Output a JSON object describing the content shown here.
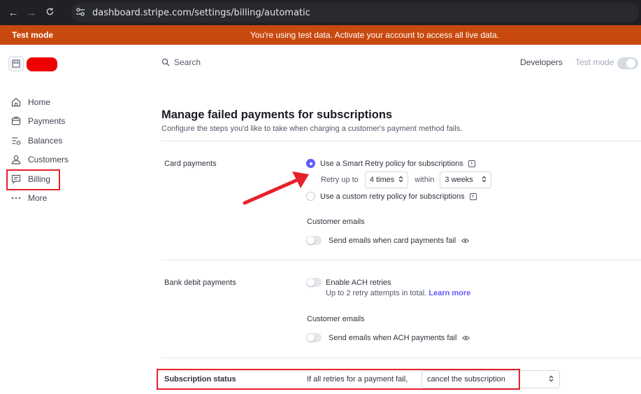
{
  "browser": {
    "url": "dashboard.stripe.com/settings/billing/automatic",
    "back": "←",
    "forward": "→",
    "reload": "C"
  },
  "banner": {
    "label": "Test mode",
    "message": "You're using test data. Activate your account to access all live data."
  },
  "sidebar": {
    "items": [
      {
        "label": "Home"
      },
      {
        "label": "Payments"
      },
      {
        "label": "Balances"
      },
      {
        "label": "Customers"
      },
      {
        "label": "Billing"
      },
      {
        "label": "More"
      }
    ]
  },
  "header": {
    "search_label": "Search",
    "developers": "Developers",
    "test_mode": "Test mode"
  },
  "page": {
    "title": "Manage failed payments for subscriptions",
    "subtitle": "Configure the steps you'd like to take when charging a customer's payment method fails."
  },
  "card": {
    "label": "Card payments",
    "smart_retry": "Use a Smart Retry policy for subscriptions",
    "retry_up_to": "Retry up to",
    "times_value": "4 times",
    "within": "within",
    "weeks_value": "3 weeks",
    "custom_retry": "Use a custom retry policy for subscriptions",
    "customer_emails": "Customer emails",
    "send_emails": "Send emails when card payments fail"
  },
  "bank": {
    "label": "Bank debit payments",
    "enable_ach": "Enable ACH retries",
    "helper": "Up to 2 retry attempts in total.",
    "learn_more": "Learn more",
    "customer_emails": "Customer emails",
    "send_emails": "Send emails when ACH payments fail"
  },
  "status": {
    "label": "Subscription status",
    "text": "If all retries for a payment fail,",
    "select_value": "cancel the subscription"
  },
  "icons": {
    "info": "i",
    "chevron": "⌃⌄"
  },
  "colors": {
    "accent": "#635bff",
    "banner": "#c8490e",
    "highlight": "#e8202a"
  }
}
